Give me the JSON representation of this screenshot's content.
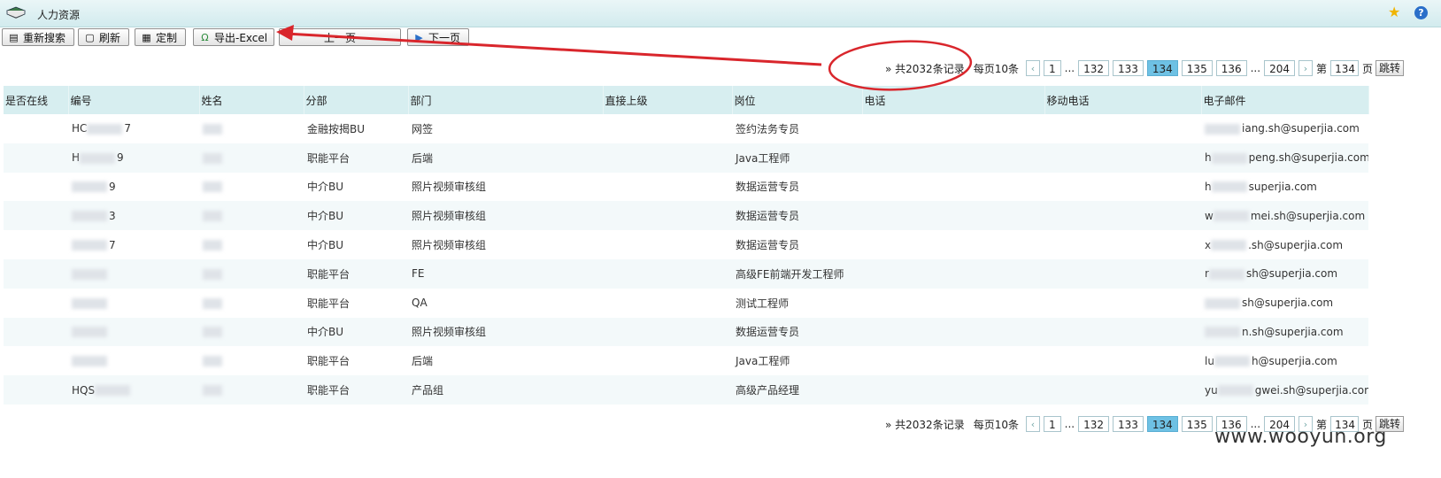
{
  "window": {
    "title": "人力资源",
    "app_icon": "books-icon",
    "star_icon": "star-icon",
    "help_icon": "help-icon",
    "help_glyph": "?"
  },
  "toolbar": {
    "search_label": "重新搜索",
    "refresh_label": "刷新",
    "customize_label": "定制",
    "export_label": "导出-Excel",
    "prev_label": "上一页",
    "next_label": "下一页"
  },
  "pager": {
    "total_text": "» 共2032条记录",
    "page_size_text": "每页10条",
    "prev_arrow": "‹",
    "next_arrow": "›",
    "first": "1",
    "ellipsis": "...",
    "pages": [
      "132",
      "133",
      "134",
      "135",
      "136"
    ],
    "current": "134",
    "last": "204",
    "jump_prefix": "第",
    "jump_value": "134",
    "jump_suffix": "页",
    "jump_button": "跳转"
  },
  "table": {
    "columns": [
      "是否在线",
      "编号",
      "姓名",
      "分部",
      "部门",
      "直接上级",
      "岗位",
      "电话",
      "移动电话",
      "电子邮件"
    ],
    "rows": [
      {
        "online": "",
        "id_pre": "HC",
        "id_post": "7",
        "name": "",
        "branch": "金融按揭BU",
        "dept": "网签",
        "manager": "",
        "post": "签约法务专员",
        "phone": "",
        "mobile": "",
        "email_pre": "",
        "email_post": "iang.sh@superjia.com"
      },
      {
        "online": "",
        "id_pre": "H",
        "id_post": "9",
        "name": "",
        "branch": "职能平台",
        "dept": "后端",
        "manager": "",
        "post": "Java工程师",
        "phone": "",
        "mobile": "",
        "email_pre": "h",
        "email_post": "peng.sh@superjia.com"
      },
      {
        "online": "",
        "id_pre": "",
        "id_post": "9",
        "name": "",
        "branch": "中介BU",
        "dept": "照片视频审核组",
        "manager": "",
        "post": "数据运营专员",
        "phone": "",
        "mobile": "",
        "email_pre": "h",
        "email_post": "superjia.com"
      },
      {
        "online": "",
        "id_pre": "",
        "id_post": "3",
        "name": "",
        "branch": "中介BU",
        "dept": "照片视频审核组",
        "manager": "",
        "post": "数据运营专员",
        "phone": "",
        "mobile": "",
        "email_pre": "w",
        "email_post": "mei.sh@superjia.com"
      },
      {
        "online": "",
        "id_pre": "",
        "id_post": "7",
        "name": "",
        "branch": "中介BU",
        "dept": "照片视频审核组",
        "manager": "",
        "post": "数据运营专员",
        "phone": "",
        "mobile": "",
        "email_pre": "x",
        "email_post": ".sh@superjia.com"
      },
      {
        "online": "",
        "id_pre": "",
        "id_post": "",
        "name": "",
        "branch": "职能平台",
        "dept": "FE",
        "manager": "",
        "post": "高级FE前端开发工程师",
        "phone": "",
        "mobile": "",
        "email_pre": "r",
        "email_post": "sh@superjia.com"
      },
      {
        "online": "",
        "id_pre": "",
        "id_post": "",
        "name": "",
        "branch": "职能平台",
        "dept": "QA",
        "manager": "",
        "post": "测试工程师",
        "phone": "",
        "mobile": "",
        "email_pre": "",
        "email_post": "sh@superjia.com"
      },
      {
        "online": "",
        "id_pre": "",
        "id_post": "",
        "name": "",
        "branch": "中介BU",
        "dept": "照片视频审核组",
        "manager": "",
        "post": "数据运营专员",
        "phone": "",
        "mobile": "",
        "email_pre": "",
        "email_post": "n.sh@superjia.com"
      },
      {
        "online": "",
        "id_pre": "",
        "id_post": "",
        "name": "",
        "branch": "职能平台",
        "dept": "后端",
        "manager": "",
        "post": "Java工程师",
        "phone": "",
        "mobile": "",
        "email_pre": "lu",
        "email_post": "h@superjia.com"
      },
      {
        "online": "",
        "id_pre": "HQS",
        "id_post": "",
        "name": "",
        "branch": "职能平台",
        "dept": "产品组",
        "manager": "",
        "post": "高级产品经理",
        "phone": "",
        "mobile": "",
        "email_pre": "yu",
        "email_post": "gwei.sh@superjia.com"
      }
    ]
  },
  "annotation": {
    "color": "#d9262c"
  },
  "watermark": "www.wooyun.org"
}
